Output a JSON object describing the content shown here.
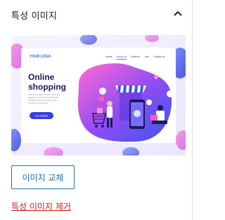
{
  "panel": {
    "title": "특성 이미지",
    "toggle_icon": "chevron-up-icon"
  },
  "image": {
    "nav": {
      "logo": "YOUR LOGO",
      "items": [
        "Home",
        "About us",
        "Portfolio",
        "Info",
        "Contact us"
      ]
    },
    "heading_line1": "Online",
    "heading_line2": "shopping",
    "body_text": [
      "Lorem ipsum dolor sit amet, consectetur",
      "adipiscing elit, sed do eiusmod tempor",
      "incididunt ut labore et dolore magna",
      "aliqua ut enim ad minim"
    ],
    "cta": "Get Started",
    "colors": {
      "purple": "#6a3cf0",
      "blue": "#3a56e8",
      "pink": "#ff5ab8",
      "navy": "#1c1a5e"
    }
  },
  "actions": {
    "replace_label": "이미지 교체",
    "remove_label": "특성 이미지 제거"
  }
}
